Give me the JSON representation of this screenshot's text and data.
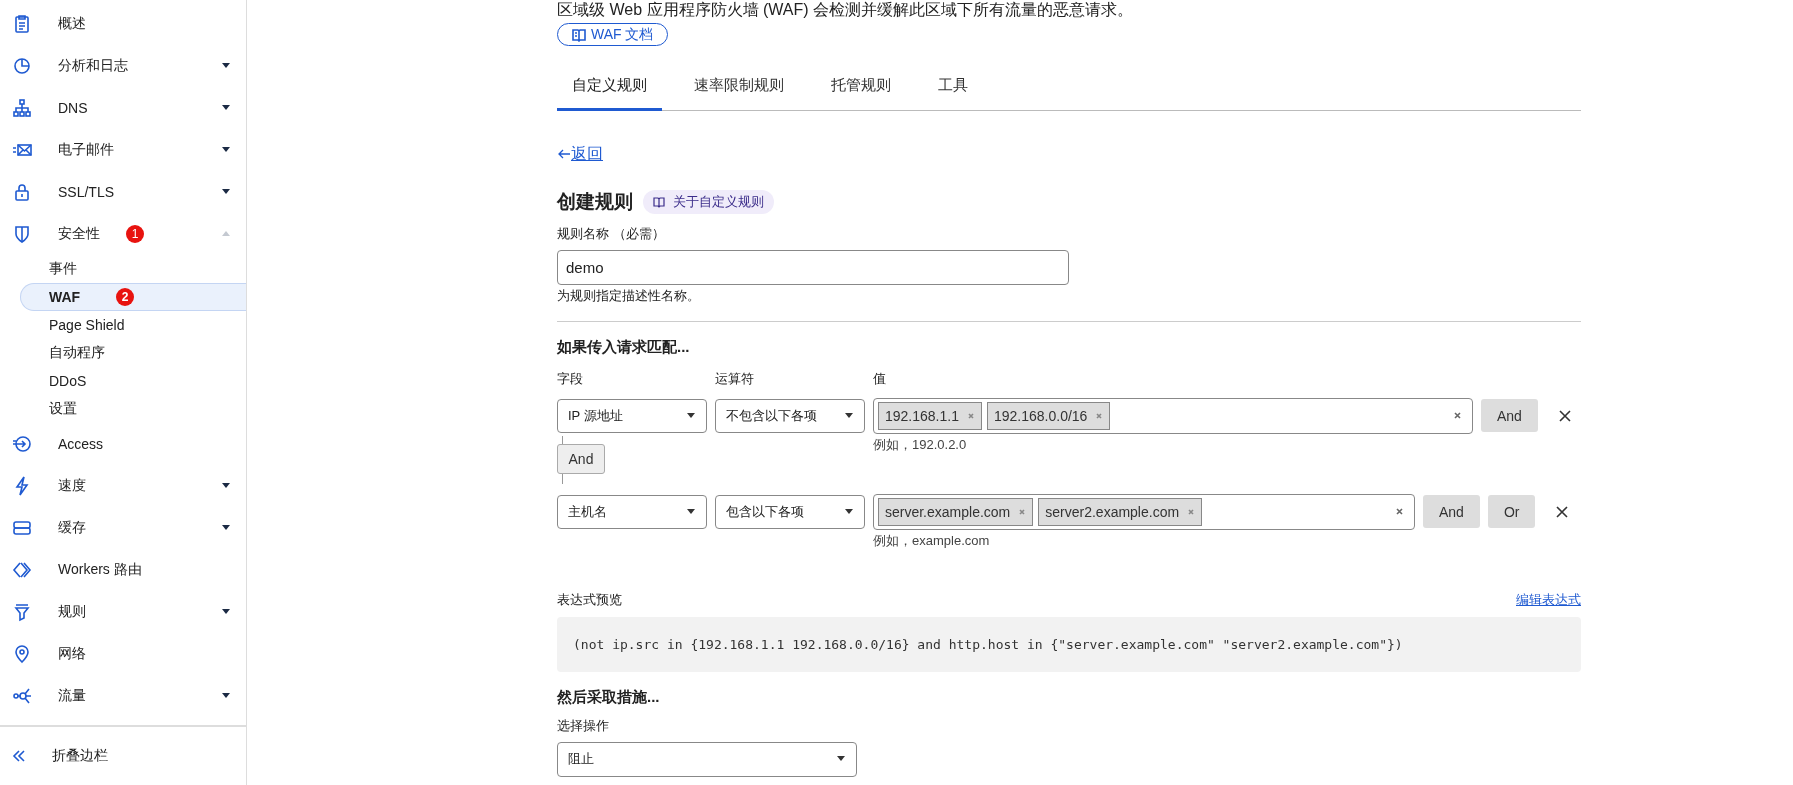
{
  "sidebar": {
    "items": [
      {
        "label": "概述"
      },
      {
        "label": "分析和日志",
        "expanded": false
      },
      {
        "label": "DNS",
        "expanded": false
      },
      {
        "label": "电子邮件",
        "expanded": false
      },
      {
        "label": "SSL/TLS",
        "expanded": false
      },
      {
        "label": "安全性",
        "expanded": true,
        "badge": "1",
        "children": [
          {
            "label": "事件",
            "selected": false
          },
          {
            "label": "WAF",
            "selected": true,
            "badge": "2"
          },
          {
            "label": "Page Shield",
            "selected": false
          },
          {
            "label": "自动程序",
            "selected": false
          },
          {
            "label": "DDoS",
            "selected": false
          },
          {
            "label": "设置",
            "selected": false
          }
        ]
      },
      {
        "label": "Access"
      },
      {
        "label": "速度",
        "expanded": false
      },
      {
        "label": "缓存",
        "expanded": false
      },
      {
        "label": "Workers 路由"
      },
      {
        "label": "规则",
        "expanded": false
      },
      {
        "label": "网络"
      },
      {
        "label": "流量",
        "expanded": false
      }
    ],
    "collapse": "折叠边栏"
  },
  "description": "区域级 Web 应用程序防火墙 (WAF) 会检测并缓解此区域下所有流量的恶意请求。",
  "docs_button": "WAF 文档",
  "tabs": [
    {
      "label": "自定义规则",
      "selected": true
    },
    {
      "label": "速率限制规则",
      "selected": false
    },
    {
      "label": "托管规则",
      "selected": false
    },
    {
      "label": "工具",
      "selected": false
    }
  ],
  "back_link": "返回",
  "heading": "创建规则",
  "heading_badge": "关于自定义规则",
  "rule_name": {
    "label": "规则名称 （必需）",
    "value": "demo",
    "hint": "为规则指定描述性名称。"
  },
  "match": {
    "title": "如果传入请求匹配...",
    "columns": [
      "字段",
      "运算符",
      "值"
    ],
    "rows": [
      {
        "field": "IP 源地址",
        "operator": "不包含以下各项",
        "values": [
          "192.168.1.1",
          "192.168.0.0/16"
        ],
        "example": "例如，192.0.2.0",
        "buttons": [
          "And"
        ]
      },
      {
        "field": "主机名",
        "operator": "包含以下各项",
        "values": [
          "server.example.com",
          "server2.example.com"
        ],
        "example": "例如，example.com",
        "buttons": [
          "And",
          "Or"
        ]
      }
    ],
    "connector": "And"
  },
  "expression": {
    "label": "表达式预览",
    "edit_link": "编辑表达式",
    "text": "(not ip.src in {192.168.1.1 192.168.0.0/16} and http.host in {\"server.example.com\" \"server2.example.com\"})"
  },
  "action": {
    "title": "然后采取措施...",
    "label": "选择操作",
    "value": "阻止"
  }
}
